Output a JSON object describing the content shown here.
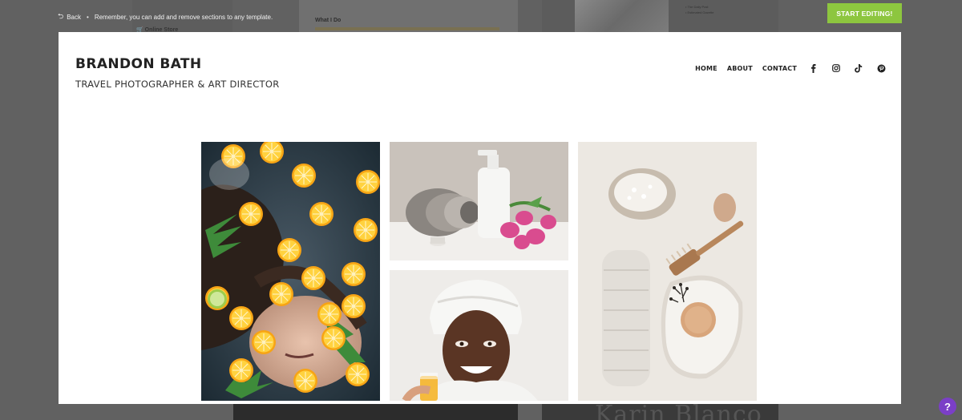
{
  "topbar": {
    "back_label": "Back",
    "separator": "•",
    "hint": "Remember, you can add and remove sections to any template.",
    "start_editing_label": "START EDITING!"
  },
  "background_template": {
    "what_i_do": "What I Do",
    "online_store": "Online Store",
    "right_list_1": "The Daily Post",
    "right_list_2": "Estimated Gazette",
    "bottom_heading": "Karin Blanco"
  },
  "site": {
    "title": "BRANDON BATH",
    "subtitle": "TRAVEL PHOTOGRAPHER & ART DIRECTOR",
    "nav": [
      "HOME",
      "ABOUT",
      "CONTACT"
    ],
    "social_icons": [
      "facebook-icon",
      "instagram-icon",
      "tiktok-icon",
      "pinterest-icon"
    ]
  },
  "gallery": {
    "images": [
      "woman-in-bath-with-orange-slices",
      "towel-bottle-candle-tulips",
      "woman-with-face-mask-and-juice",
      "bath-salt-brush-towel-soap"
    ]
  },
  "help_label": "?",
  "colors": {
    "accent_green": "#8dc63f",
    "help_purple": "#7b3fc7"
  }
}
